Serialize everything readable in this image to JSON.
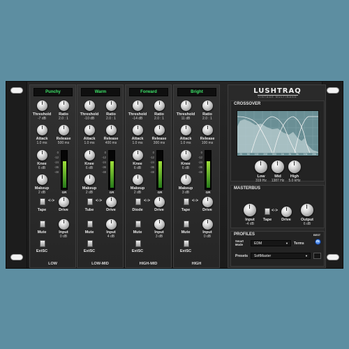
{
  "plugin": {
    "brand": "LUSHTRAQ",
    "brand_subtitle": "VINTAGE MULTIBAND"
  },
  "colors": {
    "background": "#5d8ea1",
    "rack": "#222222",
    "preset_text": "#3ee66a",
    "knob": "#d5d5d5",
    "meter_green": "#7ccf2f",
    "graph_bg": "#6a8f95",
    "best_button": "#2f79e6"
  },
  "channels": [
    {
      "preset": "Punchy",
      "threshold_label": "Threshold",
      "threshold_value": "-7 dB",
      "ratio_label": "Ratio",
      "ratio_value": "2.0 : 1",
      "attack_label": "Attack",
      "attack_value": "1.0 ms",
      "release_label": "Release",
      "release_value": "500 ms",
      "knee_label": "Knee",
      "knee_value": "6 dB",
      "makeup_label": "Makeup",
      "makeup_value": "2 dB",
      "meter_label": "GR",
      "meter_level": 0.72,
      "saturation_label": "Tape",
      "drive_label": "Drive",
      "arrow": "<->",
      "mute_label": "Mute",
      "input_label": "Input",
      "input_value": "0 dB",
      "extsc_label": "ExtSC",
      "band": "LOW"
    },
    {
      "preset": "Warm",
      "threshold_label": "Threshold",
      "threshold_value": "-10 dB",
      "ratio_label": "Ratio",
      "ratio_value": "2.0 : 1",
      "attack_label": "Attack",
      "attack_value": "1.0 ms",
      "release_label": "Release",
      "release_value": "400 ms",
      "knee_label": "Knee",
      "knee_value": "6 dB",
      "makeup_label": "Makeup",
      "makeup_value": "2 dB",
      "meter_label": "GR",
      "meter_level": 0.72,
      "saturation_label": "Tube",
      "drive_label": "Drive",
      "arrow": "<->",
      "mute_label": "Mute",
      "input_label": "Input",
      "input_value": "4 dB",
      "extsc_label": "ExtSC",
      "band": "LOW-MID"
    },
    {
      "preset": "Forward",
      "threshold_label": "Threshold",
      "threshold_value": "-14 dB",
      "ratio_label": "Ratio",
      "ratio_value": "2.0 : 1",
      "attack_label": "Attack",
      "attack_value": "1.0 ms",
      "release_label": "Release",
      "release_value": "300 ms",
      "knee_label": "Knee",
      "knee_value": "6 dB",
      "makeup_label": "Makeup",
      "makeup_value": "2 dB",
      "meter_label": "GR",
      "meter_level": 0.72,
      "saturation_label": "Diode",
      "drive_label": "Drive",
      "arrow": "<->",
      "mute_label": "Mute",
      "input_label": "Input",
      "input_value": "3 dB",
      "extsc_label": "ExtSC",
      "band": "HIGH-MID"
    },
    {
      "preset": "Bright",
      "threshold_label": "Threshold",
      "threshold_value": "11 dB",
      "ratio_label": "Ratio",
      "ratio_value": "2.0 : 1",
      "attack_label": "Attack",
      "attack_value": "1.0 ms",
      "release_label": "Release",
      "release_value": "100 ms",
      "knee_label": "Knee",
      "knee_value": "6 dB",
      "makeup_label": "Makeup",
      "makeup_value": "3 dB",
      "meter_label": "GR",
      "meter_level": 0.72,
      "saturation_label": "Tape",
      "drive_label": "Drive",
      "arrow": "<->",
      "mute_label": "Mute",
      "input_label": "Input",
      "input_value": "0 dB",
      "extsc_label": "ExtSC",
      "band": "HIGH"
    }
  ],
  "meter_scale": [
    "0",
    "-12",
    "-24",
    "-36",
    "-48"
  ],
  "crossover": {
    "title": "CROSSOVER",
    "freq_labels": [
      "20",
      "50",
      "100",
      "200",
      "500",
      "1k",
      "2k",
      "5k",
      "10k",
      "20k"
    ],
    "low_label": "Low",
    "low_value": "319 Hz",
    "mid_label": "Mid",
    "mid_value": "1387 Hz",
    "high_label": "High",
    "high_value": "5.0 kHz"
  },
  "masterbus": {
    "title": "MASTERBUS",
    "input_label": "Input",
    "input_value": "-4 dB",
    "tape_label": "Tape",
    "arrow": "<->",
    "drive_label": "Drive",
    "output_label": "Output",
    "output_value": "6 dB"
  },
  "profiles": {
    "title": "PROFILES",
    "smart_mode_label": "Smart\nMode",
    "smart_mode_value": "EDM",
    "terms_label": "Terms",
    "best_label": "BEST",
    "best_button_text": "FX",
    "presets_label": "Presets",
    "presets_value": "SoftMaster"
  }
}
